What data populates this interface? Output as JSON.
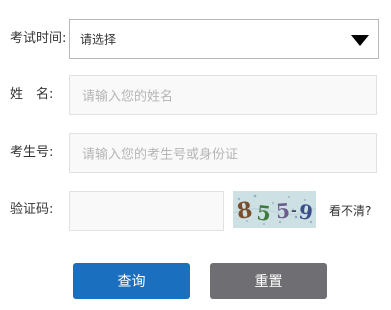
{
  "exam_time": {
    "label": "考试时间:",
    "selected": "请选择"
  },
  "name": {
    "label": "姓　名:",
    "placeholder": "请输入您的姓名"
  },
  "exam_number": {
    "label": "考生号:",
    "placeholder": "请输入您的考生号或身份证"
  },
  "captcha": {
    "label": "验证码:",
    "image_text": "8559",
    "refresh_label": "看不清?"
  },
  "buttons": {
    "query": "查询",
    "reset": "重置"
  },
  "colors": {
    "query_button": "#1a6fbe",
    "reset_button": "#6f6f73"
  }
}
